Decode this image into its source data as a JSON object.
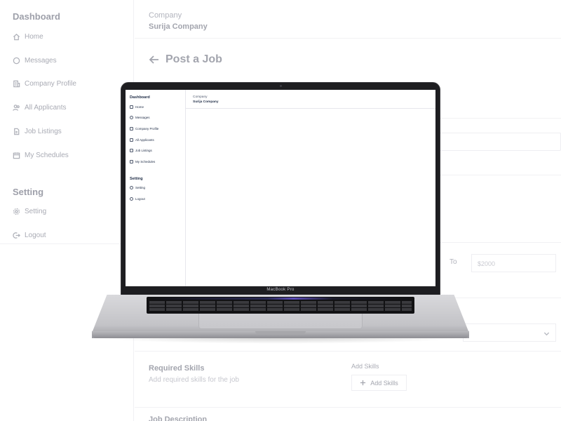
{
  "sidebar": {
    "dashboard_title": "Dashboard",
    "items": [
      {
        "label": "Home",
        "icon": "home-icon"
      },
      {
        "label": "Messages",
        "icon": "chat-icon"
      },
      {
        "label": "Company Profile",
        "icon": "building-icon"
      },
      {
        "label": "All Applicants",
        "icon": "users-icon"
      },
      {
        "label": "Job Listings",
        "icon": "document-icon"
      },
      {
        "label": "My Schedules",
        "icon": "calendar-icon"
      }
    ],
    "setting_title": "Setting",
    "setting_items": [
      {
        "label": "Setting",
        "icon": "gear-icon"
      },
      {
        "label": "Logout",
        "icon": "logout-icon"
      }
    ]
  },
  "header": {
    "company_label": "Company",
    "company_name": "Surija Company"
  },
  "page": {
    "title": "Post a Job",
    "salary_to_label": "To",
    "salary_to_placeholder": "$2000",
    "required_skills_title": "Required Skills",
    "required_skills_sub": "Add required skills for the job",
    "add_skills_label": "Add Skills",
    "add_skills_button": "Add Skills",
    "job_description_title": "Job Description"
  },
  "laptop": {
    "model_label": "MacBook Pro"
  }
}
